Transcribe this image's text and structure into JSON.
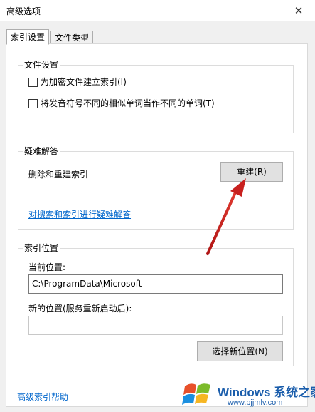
{
  "window": {
    "title": "高级选项",
    "close_glyph": "✕"
  },
  "tabs": [
    {
      "label": "索引设置",
      "active": true
    },
    {
      "label": "文件类型",
      "active": false
    }
  ],
  "file_settings": {
    "title": "文件设置",
    "options": [
      {
        "label": "为加密文件建立索引(I)",
        "checked": false
      },
      {
        "label": "将发音符号不同的相似单词当作不同的单词(T)",
        "checked": false
      }
    ]
  },
  "troubleshoot": {
    "title": "疑难解答",
    "description": "删除和重建索引",
    "rebuild_button": "重建(R)",
    "link": "对搜索和索引进行疑难解答"
  },
  "index_location": {
    "title": "索引位置",
    "current_label": "当前位置:",
    "current_value": "C:\\ProgramData\\Microsoft",
    "new_label": "新的位置(服务重新启动后):",
    "new_value": "",
    "select_button": "选择新位置(N)"
  },
  "footer": {
    "help_link": "高级索引帮助"
  },
  "watermark": {
    "brand": "Windows 系统之家",
    "url": "www.bjjmlv.com"
  },
  "colors": {
    "arrow": "#c8201e",
    "link": "#0066cc",
    "watermark": "#1a5dab"
  }
}
